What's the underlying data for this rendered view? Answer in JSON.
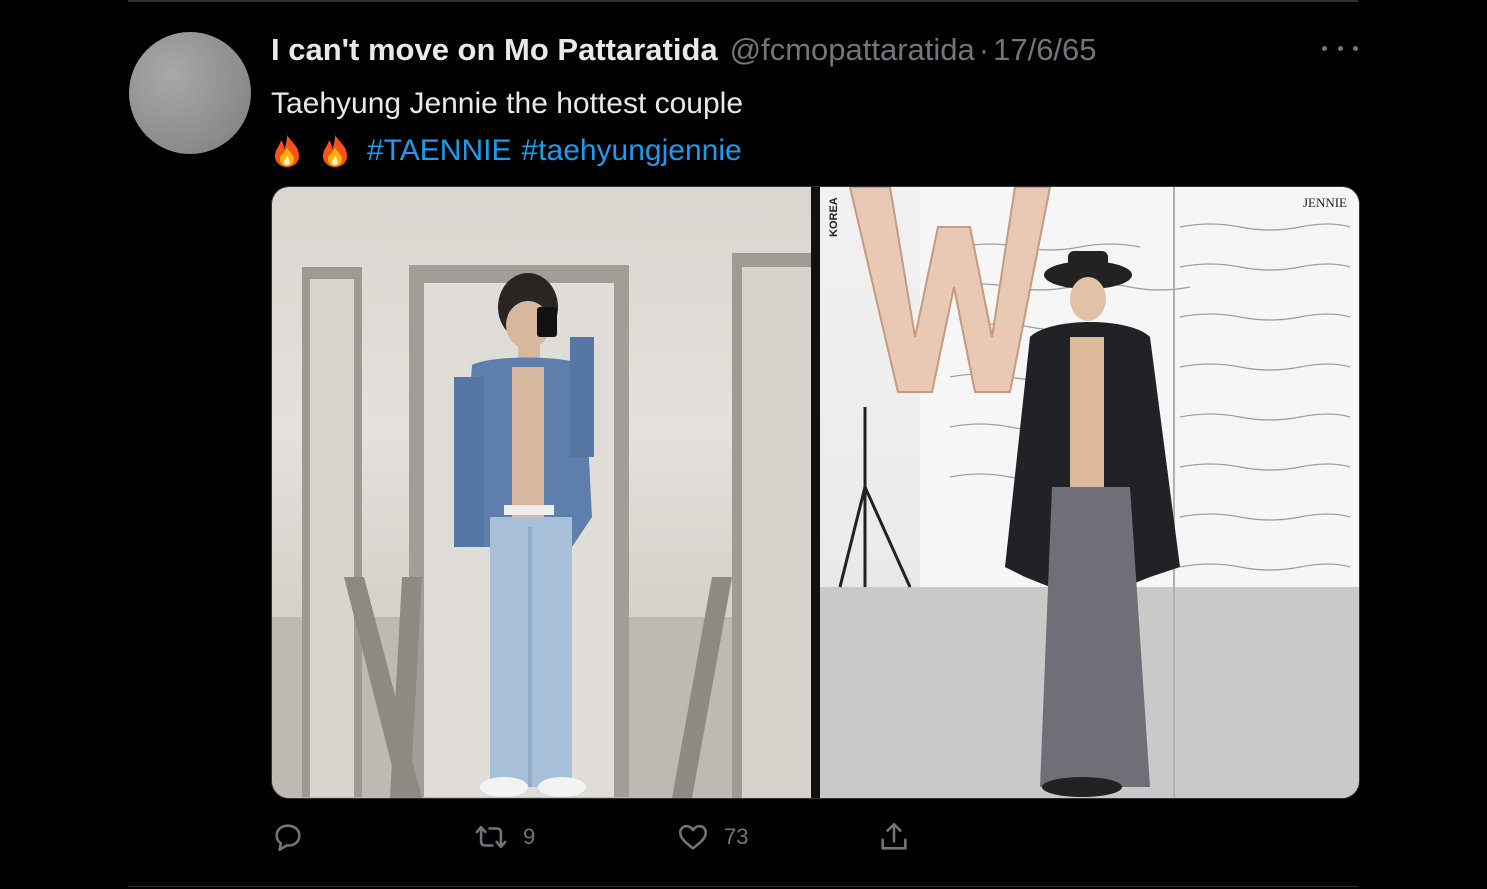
{
  "tweet": {
    "author": {
      "display_name": "I can't move on Mo Pattaratida",
      "handle": "@fcmopattaratida",
      "separator": "·",
      "date": "17/6/65"
    },
    "text": "Taehyung Jennie the hottest couple",
    "emojis": [
      "fire-emoji",
      "fire-emoji"
    ],
    "hashtags": [
      "#TAENNIE",
      "#taehyungjennie"
    ],
    "media": {
      "left_image_description": "man-mirror-selfie",
      "right_image": {
        "magazine_letter": "W",
        "country_label": "KOREA",
        "cover_name": "JENNIE"
      }
    },
    "actions": {
      "reply": {
        "icon": "reply-icon",
        "count": ""
      },
      "retweet": {
        "icon": "retweet-icon",
        "count": "9"
      },
      "like": {
        "icon": "heart-icon",
        "count": "73"
      },
      "share": {
        "icon": "share-icon"
      }
    }
  },
  "colors": {
    "background": "#000000",
    "text": "#e7e9ea",
    "muted": "#71767b",
    "link": "#1d9bf0",
    "border": "#2f3336"
  }
}
